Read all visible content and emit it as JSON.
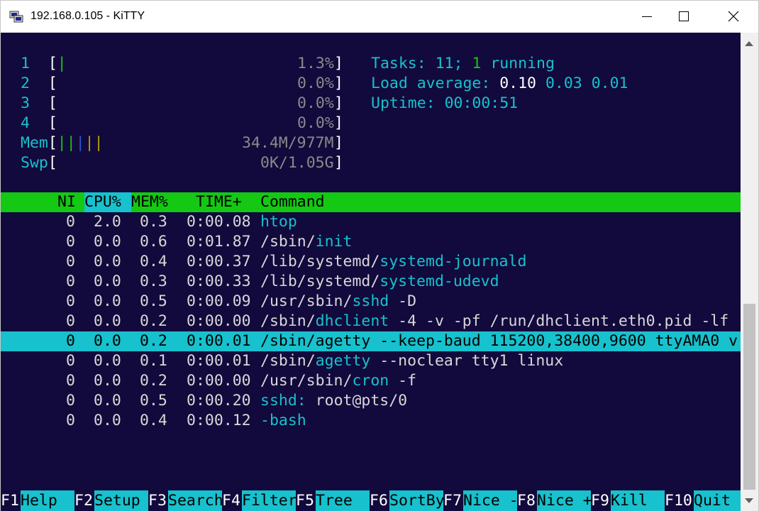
{
  "window": {
    "title": "192.168.0.105 - KiTTY"
  },
  "meters": {
    "cpu": [
      {
        "label": "1",
        "bar": "|",
        "value": "1.3%"
      },
      {
        "label": "2",
        "bar": "",
        "value": "0.0%"
      },
      {
        "label": "3",
        "bar": "",
        "value": "0.0%"
      },
      {
        "label": "4",
        "bar": "",
        "value": "0.0%"
      }
    ],
    "mem": {
      "label": "Mem",
      "bar_a": "||",
      "bar_b": "|",
      "bar_c": "||",
      "value": "34.4M/977M"
    },
    "swp": {
      "label": "Swp",
      "value": "0K/1.05G"
    }
  },
  "summary": {
    "tasks_label": "Tasks: ",
    "tasks": "11",
    "tasks_sep": "; ",
    "running": "1",
    "running_label": " running",
    "load_label": "Load average: ",
    "load1": "0.10",
    "load5": "0.03",
    "load15": "0.01",
    "uptime_label": "Uptime: ",
    "uptime": "00:00:51"
  },
  "columns": [
    "NI",
    "CPU%",
    "MEM%",
    "TIME+",
    "Command"
  ],
  "processes": [
    {
      "ni": "0",
      "cpu": "2.0",
      "mem": "0.3",
      "time": "0:00.08",
      "cmd_dir": "",
      "cmd_name": "htop",
      "cmd_args": ""
    },
    {
      "ni": "0",
      "cpu": "0.0",
      "mem": "0.6",
      "time": "0:01.87",
      "cmd_dir": "/sbin/",
      "cmd_name": "init",
      "cmd_args": ""
    },
    {
      "ni": "0",
      "cpu": "0.0",
      "mem": "0.4",
      "time": "0:00.37",
      "cmd_dir": "/lib/systemd/",
      "cmd_name": "systemd-journald",
      "cmd_args": ""
    },
    {
      "ni": "0",
      "cpu": "0.0",
      "mem": "0.3",
      "time": "0:00.33",
      "cmd_dir": "/lib/systemd/",
      "cmd_name": "systemd-udevd",
      "cmd_args": ""
    },
    {
      "ni": "0",
      "cpu": "0.0",
      "mem": "0.5",
      "time": "0:00.09",
      "cmd_dir": "/usr/sbin/",
      "cmd_name": "sshd",
      "cmd_args": " -D"
    },
    {
      "ni": "0",
      "cpu": "0.0",
      "mem": "0.2",
      "time": "0:00.00",
      "cmd_dir": "/sbin/",
      "cmd_name": "dhclient",
      "cmd_args": " -4 -v -pf /run/dhclient.eth0.pid -lf"
    },
    {
      "ni": "0",
      "cpu": "0.0",
      "mem": "0.2",
      "time": "0:00.01",
      "cmd_dir": "/sbin/",
      "cmd_name": "agetty",
      "cmd_args": " --keep-baud 115200,38400,9600 ttyAMA0 v",
      "selected": true
    },
    {
      "ni": "0",
      "cpu": "0.0",
      "mem": "0.1",
      "time": "0:00.01",
      "cmd_dir": "/sbin/",
      "cmd_name": "agetty",
      "cmd_args": " --noclear tty1 linux"
    },
    {
      "ni": "0",
      "cpu": "0.0",
      "mem": "0.2",
      "time": "0:00.00",
      "cmd_dir": "/usr/sbin/",
      "cmd_name": "cron",
      "cmd_args": " -f"
    },
    {
      "ni": "0",
      "cpu": "0.0",
      "mem": "0.5",
      "time": "0:00.20",
      "cmd_dir": "",
      "cmd_name": "sshd:",
      "cmd_args": " root@pts/0"
    },
    {
      "ni": "0",
      "cpu": "0.0",
      "mem": "0.4",
      "time": "0:00.12",
      "cmd_dir": "",
      "cmd_name": "-bash",
      "cmd_args": ""
    }
  ],
  "function_keys": [
    {
      "key": "F1",
      "label": "Help  "
    },
    {
      "key": "F2",
      "label": "Setup "
    },
    {
      "key": "F3",
      "label": "Search"
    },
    {
      "key": "F4",
      "label": "Filter"
    },
    {
      "key": "F5",
      "label": "Tree  "
    },
    {
      "key": "F6",
      "label": "SortBy"
    },
    {
      "key": "F7",
      "label": "Nice -"
    },
    {
      "key": "F8",
      "label": "Nice +"
    },
    {
      "key": "F9",
      "label": "Kill  "
    },
    {
      "key": "F10",
      "label": "Quit  "
    }
  ],
  "colors": {
    "terminal_bg": "#120a3c",
    "cyan": "#17c1cd",
    "green": "#14c814",
    "text": "#d8d8d8"
  }
}
